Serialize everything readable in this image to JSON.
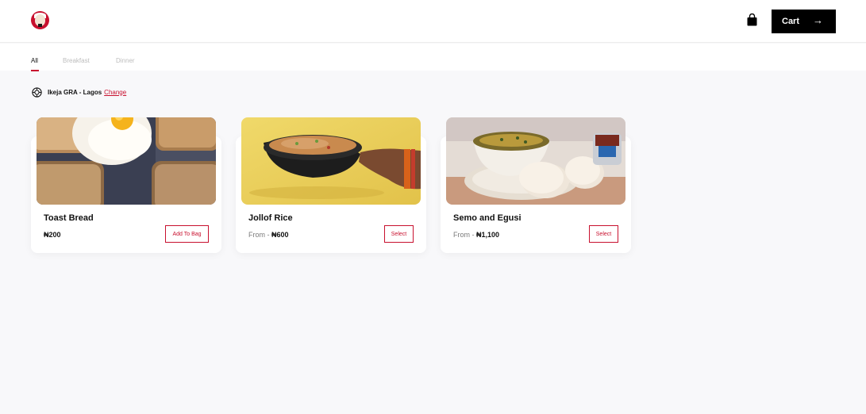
{
  "header": {
    "logo_name": "kfc-logo",
    "cart_label": "Cart",
    "cart_arrow": "→"
  },
  "tabs": [
    {
      "label": "All",
      "active": true
    },
    {
      "label": "Breakfast",
      "active": false
    },
    {
      "label": "Dinner",
      "active": false
    }
  ],
  "location": {
    "text": "Ikeja GRA - Lagos",
    "change_label": "Change"
  },
  "products": [
    {
      "title": "Toast Bread",
      "from_label": "",
      "price": "₦200",
      "button_label": "Add To Bag",
      "image": "toast-bread-with-fried-egg"
    },
    {
      "title": "Jollof Rice",
      "from_label": "From - ",
      "price": "₦600",
      "button_label": "Select",
      "image": "jollof-rice-pan"
    },
    {
      "title": "Semo and Egusi",
      "from_label": "From - ",
      "price": "₦1,100",
      "button_label": "Select",
      "image": "semo-and-egusi-bowl"
    }
  ],
  "colors": {
    "brand": "#c8102e",
    "background": "#f8f8fa",
    "cart_button": "#000000"
  }
}
